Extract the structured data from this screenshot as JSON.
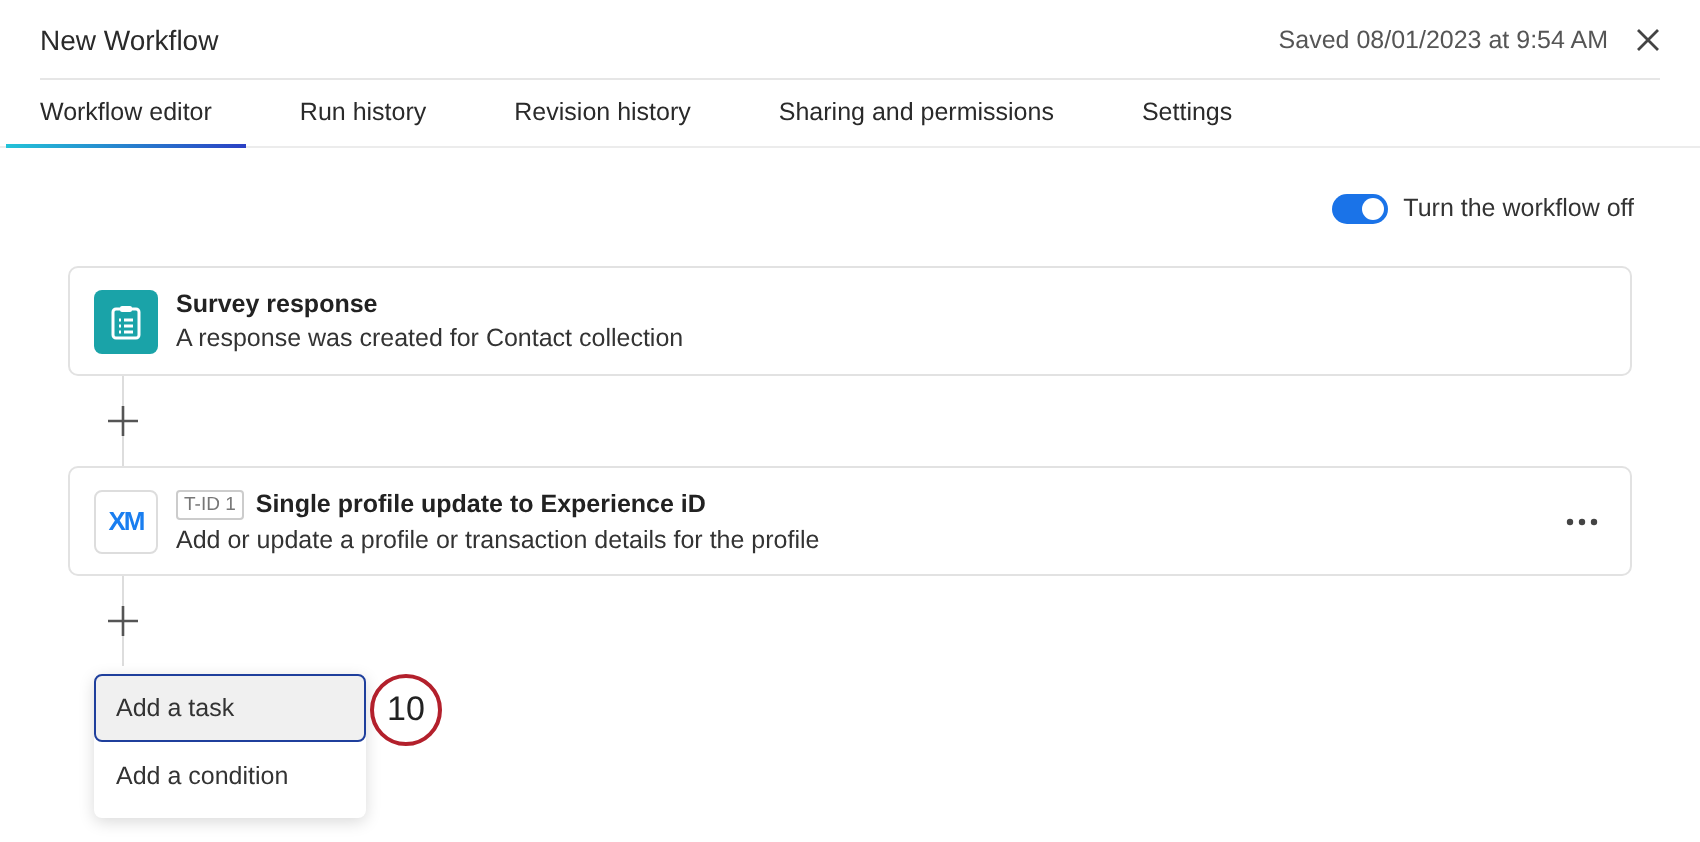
{
  "window": {
    "title": "New Workflow",
    "saved": "Saved 08/01/2023 at 9:54 AM"
  },
  "tabs": [
    {
      "label": "Workflow editor",
      "selected": true
    },
    {
      "label": "Run history",
      "selected": false
    },
    {
      "label": "Revision history",
      "selected": false
    },
    {
      "label": "Sharing and permissions",
      "selected": false
    },
    {
      "label": "Settings",
      "selected": false
    }
  ],
  "toggle": {
    "label": "Turn the workflow off",
    "on": true
  },
  "steps": [
    {
      "kind": "trigger",
      "title": "Survey response",
      "description": "A response was created for Contact collection"
    },
    {
      "kind": "task",
      "logo": "XM",
      "tag": "T-ID 1",
      "title": "Single profile update to Experience iD",
      "description": "Add or update a profile or transaction details for the profile"
    }
  ],
  "menu": [
    {
      "label": "Add a task",
      "selected": true
    },
    {
      "label": "Add a condition",
      "selected": false
    }
  ],
  "callout": "10"
}
